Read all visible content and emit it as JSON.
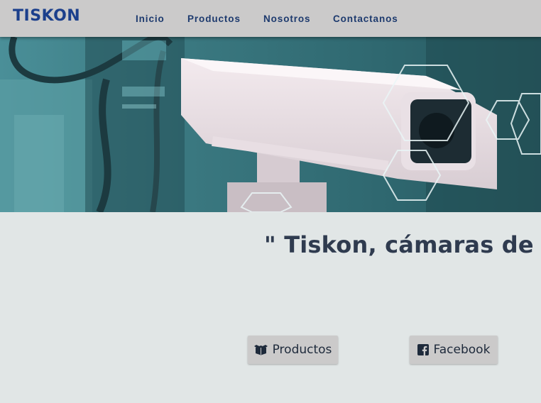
{
  "brand": {
    "logo_text": "TISKON",
    "color": "#1b3f8c"
  },
  "nav": {
    "items": [
      {
        "label": "Inicio"
      },
      {
        "label": "Productos"
      },
      {
        "label": "Nosotros"
      },
      {
        "label": "Contactanos"
      }
    ]
  },
  "hero": {
    "image": "security-camera-hero"
  },
  "tagline": "\" Tiskon, cámaras de seg",
  "buttons": {
    "products": {
      "label": "Productos",
      "icon": "box-icon"
    },
    "facebook": {
      "label": "Facebook",
      "icon": "facebook-icon"
    }
  },
  "colors": {
    "navbar_bg": "#cbcaca",
    "page_bg": "#e1e6e6",
    "nav_text": "#1d3a6e",
    "tagline_text": "#2f3b4f"
  }
}
